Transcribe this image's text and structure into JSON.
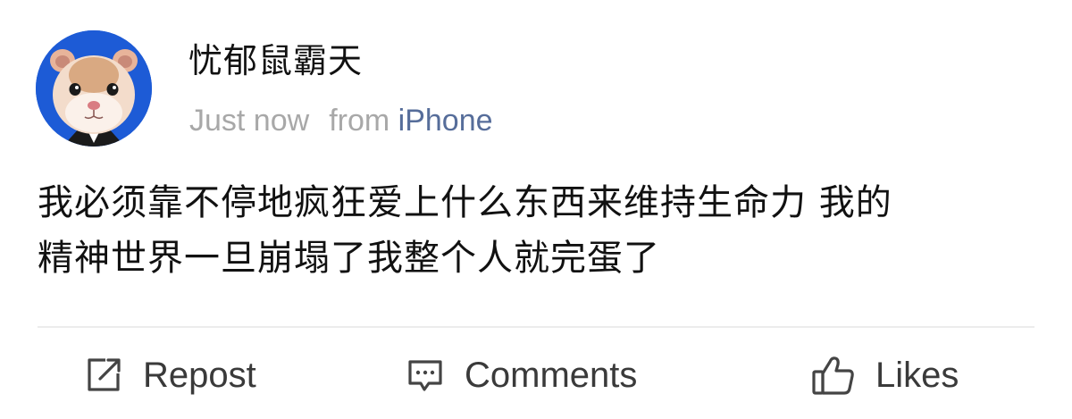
{
  "post": {
    "username": "忧郁鼠霸天",
    "timestamp": "Just now",
    "from_label": "from",
    "source": "iPhone",
    "content_line1": "我必须靠不停地疯狂爱上什么东西来维持生命力 我的",
    "content_line2": "精神世界一旦崩塌了我整个人就完蛋了"
  },
  "actions": {
    "repost_label": "Repost",
    "comments_label": "Comments",
    "likes_label": "Likes"
  },
  "colors": {
    "avatar_background": "#1d5bd6",
    "source_link": "#566d9a",
    "meta_text": "#a8a8a8",
    "divider": "#ececec"
  },
  "icons": {
    "avatar": "hamster-avatar",
    "repost": "repost-icon",
    "comments": "comment-icon",
    "likes": "thumbs-up-icon"
  }
}
